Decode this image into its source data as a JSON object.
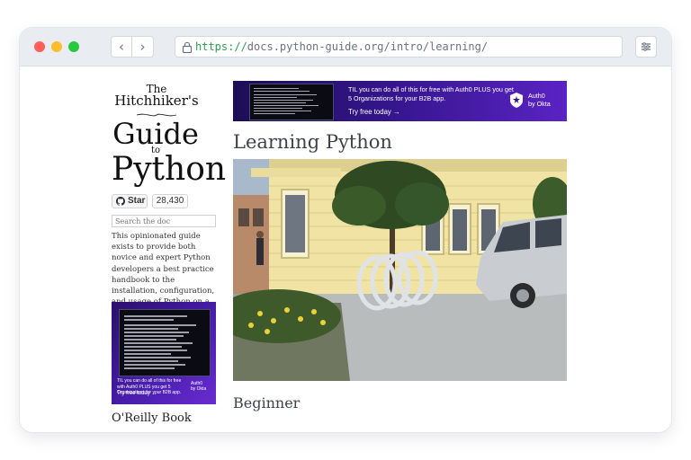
{
  "browser": {
    "url_scheme": "https://",
    "url_rest": "docs.python-guide.org/intro/learning/",
    "back_label": "‹",
    "forward_label": "›"
  },
  "sidebar": {
    "logo": {
      "line1": "The",
      "line2": "Hitchhiker's",
      "line3": "Guide",
      "line4": "to",
      "line5": "Python"
    },
    "github": {
      "star_label": "Star",
      "star_count": "28,430"
    },
    "search_placeholder": "Search the doc",
    "blurb": "This opinionated guide exists to provide both novice and expert Python developers a best practice handbook to the installation, configuration, and usage of Python on a daily basis.",
    "ad": {
      "copy": "TIL you can do all of this for free with Auth0 PLUS you get 5 Organizations for your B2B app.",
      "cta": "Try free today →",
      "brand_line1": "Auth0",
      "brand_line2": "by Okta"
    },
    "section_title": "O'Reilly Book"
  },
  "main": {
    "ad": {
      "copy": "TIL you can do all of this for free with Auth0 PLUS you get 5 Organizations for your B2B app.",
      "cta": "Try free today →",
      "brand_line1": "Auth0",
      "brand_line2": "by Okta"
    },
    "title": "Learning Python",
    "section": "Beginner"
  },
  "colors": {
    "ad_purple": "#4b1fb0",
    "heading": "#3e4349",
    "url_scheme_green": "#2e9e4f"
  }
}
